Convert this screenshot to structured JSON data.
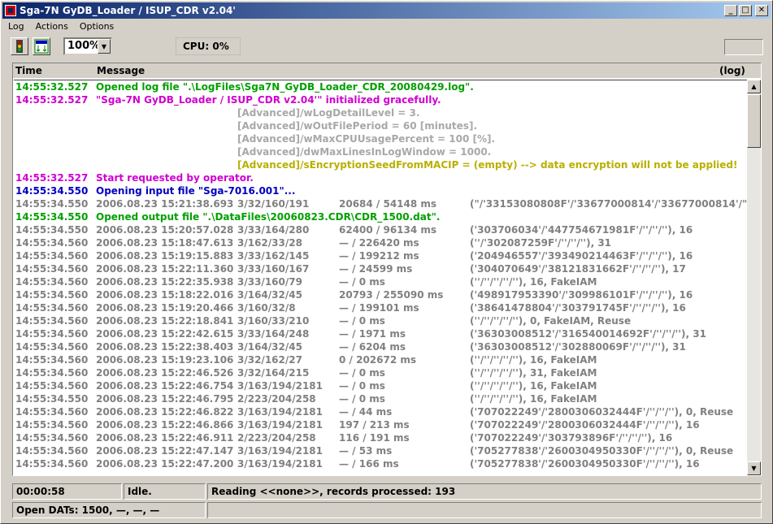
{
  "window": {
    "title": "Sga-7N GyDB_Loader / ISUP_CDR  v2.04'",
    "minimize": "_",
    "maximize": "□",
    "close": "✕"
  },
  "menu": [
    {
      "label": "Log"
    },
    {
      "label": "Actions"
    },
    {
      "label": "Options"
    }
  ],
  "toolbar": {
    "zoom": "100%",
    "cpu_label": "CPU:",
    "cpu_value": "0%"
  },
  "log": {
    "columns": {
      "time": "Time",
      "message": "Message",
      "log": "(log)"
    },
    "colors": {
      "green": "#00a000",
      "magenta": "#d000d0",
      "blue": "#0000c0",
      "gray": "#808080",
      "lightgray": "#a8a8a8",
      "olive": "#b8b000"
    },
    "rows": [
      {
        "color": "#00a000",
        "time": "14:55:32.527",
        "msg": "Opened log file \".\\LogFiles\\Sga7N_GyDB_Loader_CDR_20080429.log\"."
      },
      {
        "color": "#d000d0",
        "time": "14:55:32.527",
        "msg": "\"Sga-7N GyDB_Loader / ISUP_CDR  v2.04'\" initialized gracefully."
      },
      {
        "color": "#a8a8a8",
        "time": "",
        "detail": "[Advanced]/wLogDetailLevel = 3."
      },
      {
        "color": "#a8a8a8",
        "time": "",
        "detail": "[Advanced]/wOutFilePeriod = 60 [minutes]."
      },
      {
        "color": "#a8a8a8",
        "time": "",
        "detail": "[Advanced]/wMaxCPUUsagePercent = 100 [%]."
      },
      {
        "color": "#a8a8a8",
        "time": "",
        "detail": "[Advanced]/dwMaxLinesInLogWindow = 1000."
      },
      {
        "color": "#b8b000",
        "time": "",
        "detail": "[Advanced]/sEncryptionSeedFromMACIP = (empty)    --> data encryption will not be applied!"
      },
      {
        "color": "#d000d0",
        "time": "14:55:32.527",
        "msg": "Start requested by operator."
      },
      {
        "color": "#0000c0",
        "time": "14:55:34.550",
        "msg": "Opening input file \"Sga-7016.001\"..."
      },
      {
        "color": "#808080",
        "time": "14:55:34.550",
        "date": "2006.08.23 15:21:38.693",
        "cic": "3/32/160/191",
        "dur": "20684 / 54148 ms",
        "info": "(\"/'33153080808F'/'33677000814'/'33677000814'/\"),"
      },
      {
        "color": "#00a000",
        "time": "14:55:34.550",
        "msg": "Opened output file \".\\DataFiles\\20060823.CDR\\CDR_1500.dat\"."
      },
      {
        "color": "#808080",
        "time": "14:55:34.550",
        "date": "2006.08.23 15:20:57.028",
        "cic": "3/33/164/280",
        "dur": "62400 / 96134 ms",
        "info": "('303706034'/'447754671981F'/''/''/''), 16"
      },
      {
        "color": "#808080",
        "time": "14:55:34.560",
        "date": "2006.08.23 15:18:47.613",
        "cic": "3/162/33/28",
        "dur": "— / 226420 ms",
        "info": "(''/'302087259F'/''/''/''), 31"
      },
      {
        "color": "#808080",
        "time": "14:55:34.560",
        "date": "2006.08.23 15:19:15.883",
        "cic": "3/33/162/145",
        "dur": "— / 199212 ms",
        "info": "('204946557'/'393490214463F'/''/''/''), 16"
      },
      {
        "color": "#808080",
        "time": "14:55:34.560",
        "date": "2006.08.23 15:22:11.360",
        "cic": "3/33/160/167",
        "dur": "— / 24599 ms",
        "info": "('304070649'/'38121831662F'/''/''/''), 17"
      },
      {
        "color": "#808080",
        "time": "14:55:34.560",
        "date": "2006.08.23 15:22:35.938",
        "cic": "3/33/160/79",
        "dur": "— / 0 ms",
        "info": "(''/''/''/''/''), 16, FakeIAM"
      },
      {
        "color": "#808080",
        "time": "14:55:34.560",
        "date": "2006.08.23 15:18:22.016",
        "cic": "3/164/32/45",
        "dur": "20793 / 255090 ms",
        "info": "('498917953390'/'309986101F'/''/''/''), 16"
      },
      {
        "color": "#808080",
        "time": "14:55:34.560",
        "date": "2006.08.23 15:19:20.466",
        "cic": "3/160/32/8",
        "dur": "— / 199101 ms",
        "info": "('38641478804'/'303791745F'/''/''/''), 16"
      },
      {
        "color": "#808080",
        "time": "14:55:34.560",
        "date": "2006.08.23 15:22:18.841",
        "cic": "3/160/33/210",
        "dur": "— / 0 ms",
        "info": "(''/''/''/''/''), 0, FakeIAM, Reuse"
      },
      {
        "color": "#808080",
        "time": "14:55:34.560",
        "date": "2006.08.23 15:22:42.615",
        "cic": "3/33/164/248",
        "dur": "— / 1971 ms",
        "info": "('36303008512'/'316540014692F'/''/''/''), 31"
      },
      {
        "color": "#808080",
        "time": "14:55:34.560",
        "date": "2006.08.23 15:22:38.403",
        "cic": "3/164/32/45",
        "dur": "— / 6204 ms",
        "info": "('36303008512'/'302880069F'/''/''/''), 31"
      },
      {
        "color": "#808080",
        "time": "14:55:34.560",
        "date": "2006.08.23 15:19:23.106",
        "cic": "3/32/162/27",
        "dur": "0 / 202672 ms",
        "info": "(''/''/''/''/''), 16, FakeIAM"
      },
      {
        "color": "#808080",
        "time": "14:55:34.560",
        "date": "2006.08.23 15:22:46.526",
        "cic": "3/32/164/215",
        "dur": "— / 0 ms",
        "info": "(''/''/''/''/''), 31, FakeIAM"
      },
      {
        "color": "#808080",
        "time": "14:55:34.560",
        "date": "2006.08.23 15:22:46.754",
        "cic": "3/163/194/2181",
        "dur": "— / 0 ms",
        "info": "(''/''/''/''/''), 16, FakeIAM"
      },
      {
        "color": "#808080",
        "time": "14:55:34.550",
        "date": "2006.08.23 15:22:46.795",
        "cic": "2/223/204/258",
        "dur": "— / 0 ms",
        "info": "(''/''/''/''/''), 16, FakeIAM"
      },
      {
        "color": "#808080",
        "time": "14:55:34.560",
        "date": "2006.08.23 15:22:46.822",
        "cic": "3/163/194/2181",
        "dur": "— / 44 ms",
        "info": "('707022249'/'2800306032444F'/''/''/''), 0, Reuse"
      },
      {
        "color": "#808080",
        "time": "14:55:34.560",
        "date": "2006.08.23 15:22:46.866",
        "cic": "3/163/194/2181",
        "dur": "197 / 213 ms",
        "info": "('707022249'/'2800306032444F'/''/''/''), 16"
      },
      {
        "color": "#808080",
        "time": "14:55:34.560",
        "date": "2006.08.23 15:22:46.911",
        "cic": "2/223/204/258",
        "dur": "116 / 191 ms",
        "info": "('707022249'/'303793896F'/''/''/''), 16"
      },
      {
        "color": "#808080",
        "time": "14:55:34.560",
        "date": "2006.08.23 15:22:47.147",
        "cic": "3/163/194/2181",
        "dur": "— / 53 ms",
        "info": "('705277838'/'2600304950330F'/''/''/''), 0, Reuse"
      },
      {
        "color": "#808080",
        "time": "14:55:34.560",
        "date": "2006.08.23 15:22:47.200",
        "cic": "3/163/194/2181",
        "dur": "— / 166 ms",
        "info": "('705277838'/'2600304950330F'/''/''/''), 16"
      }
    ]
  },
  "status": {
    "elapsed": "00:00:58",
    "state": "Idle.",
    "reading": "Reading <<none>>, records processed: 193",
    "open_dats": "Open DATs: 1500, —, —, —"
  }
}
